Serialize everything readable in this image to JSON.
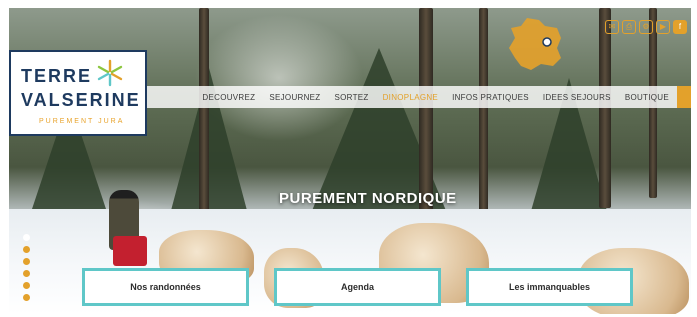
{
  "brand": {
    "name_line1": "TERRE",
    "name_line2": "VALSERINE",
    "tagline": "PUREMENT JURA"
  },
  "nav": {
    "items": [
      {
        "label": "DECOUVREZ",
        "active": false
      },
      {
        "label": "SEJOURNEZ",
        "active": false
      },
      {
        "label": "SORTEZ",
        "active": false
      },
      {
        "label": "DINOPLAGNE",
        "active": true
      },
      {
        "label": "INFOS PRATIQUES",
        "active": false
      },
      {
        "label": "IDEES SEJOURS",
        "active": false
      },
      {
        "label": "BOUTIQUE",
        "active": false
      }
    ]
  },
  "social": [
    {
      "icon": "mail-icon",
      "glyph": "✉"
    },
    {
      "icon": "print-icon",
      "glyph": "⎙"
    },
    {
      "icon": "gear-icon",
      "glyph": "⚙"
    },
    {
      "icon": "youtube-icon",
      "glyph": "▶"
    },
    {
      "icon": "facebook-icon",
      "glyph": "f"
    }
  ],
  "hero": {
    "title": "PUREMENT NORDIQUE"
  },
  "carousel": {
    "slide_count": 6,
    "active_index": 0
  },
  "cta_buttons": [
    {
      "label": "Nos randonnées"
    },
    {
      "label": "Agenda"
    },
    {
      "label": "Les immanquables"
    }
  ],
  "colors": {
    "accent": "#e3a12b",
    "brand_blue": "#1e3a5f",
    "cta_border": "#5fc7c8"
  }
}
